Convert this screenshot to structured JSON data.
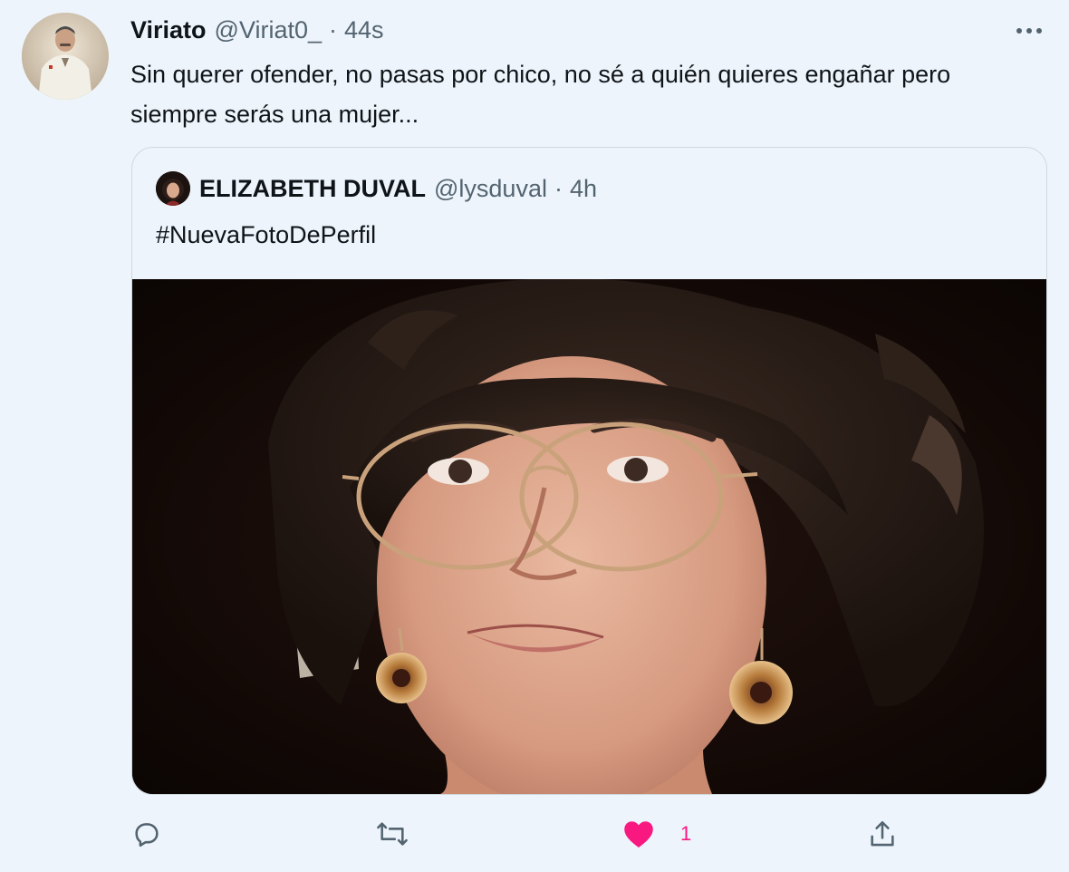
{
  "tweet": {
    "author_name": "Viriato",
    "author_handle": "@Viriat0_",
    "separator": "·",
    "time": "44s",
    "text": "Sin querer ofender, no pasas por chico, no sé a quién quieres engañar pero siempre serás una mujer...",
    "avatar_icon": "user-avatar-image"
  },
  "quote": {
    "author_name": "ELIZABETH DUVAL",
    "author_handle": "@lysduval",
    "separator": "·",
    "time": "4h",
    "text": "#NuevaFotoDePerfil"
  },
  "actions": {
    "reply_icon": "reply-icon",
    "retweet_icon": "retweet-icon",
    "like_icon": "heart-icon",
    "like_count": "1",
    "share_icon": "share-icon",
    "like_color": "#f91880"
  },
  "colors": {
    "background": "#eef4fb",
    "text_primary": "#0f1419",
    "text_secondary": "#536471",
    "border": "#cfd9de"
  }
}
